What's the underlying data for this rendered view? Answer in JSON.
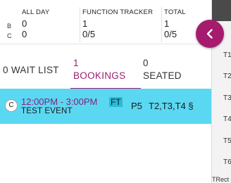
{
  "stats": {
    "row_labels": [
      "B",
      "C"
    ],
    "columns": [
      {
        "header": "ALL DAY",
        "b": "0",
        "c": "0"
      },
      {
        "header": "FUNCTION TRACKER",
        "b": "1",
        "c": "0/5"
      },
      {
        "header": "TOTAL",
        "b": "1",
        "c": "0/5"
      }
    ]
  },
  "tabs": [
    {
      "count": "0",
      "label": "WAIT LIST"
    },
    {
      "count": "1",
      "label": "BOOKINGS"
    },
    {
      "count": "0",
      "label": "SEATED"
    }
  ],
  "booking": {
    "badge": "C",
    "time": "12:00PM - 3:00PM",
    "tag": "FT",
    "name": "TEST EVENT",
    "party": "P5",
    "tables": "T2,T3,T4 §"
  },
  "right_panel": {
    "tables": [
      "T1",
      "T2",
      "T3",
      "T4",
      "T5",
      "T6"
    ],
    "footer": "TRect"
  },
  "colors": {
    "accent": "#9a1f72",
    "booking_bg": "#5ad8f2",
    "fab": "#a51c6e"
  },
  "icons": {
    "collapse": "chevron-left-icon"
  }
}
